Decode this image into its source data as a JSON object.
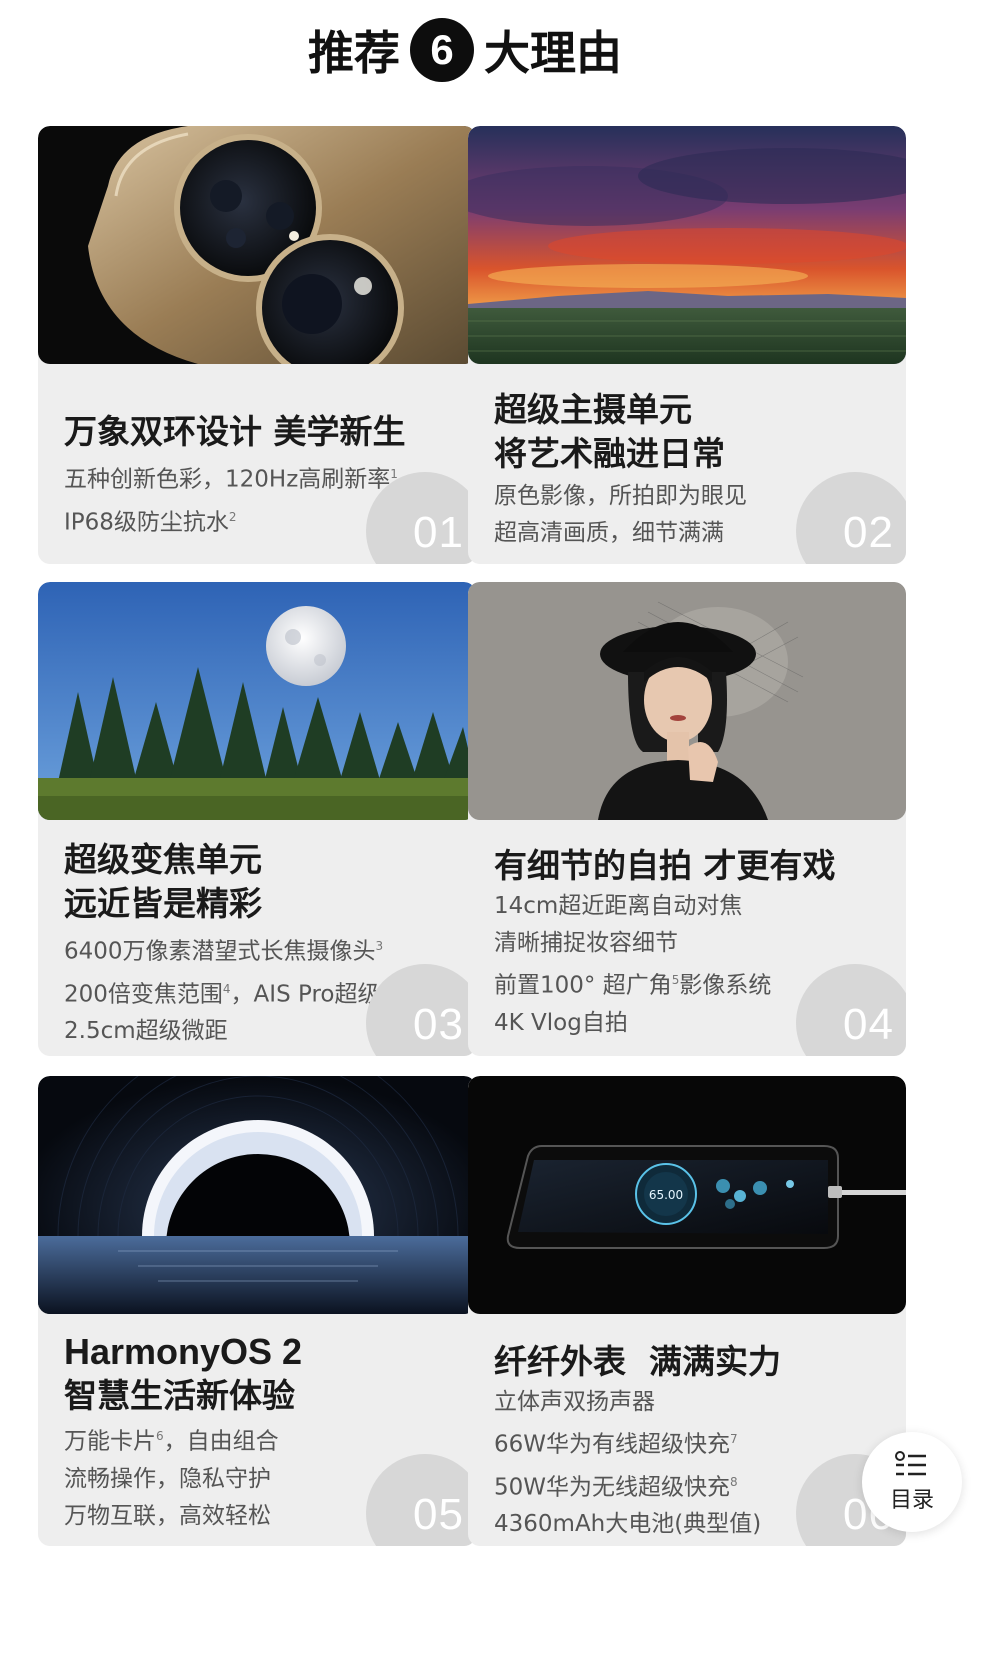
{
  "header": {
    "title_prefix": "推荐",
    "title_number": "6",
    "title_suffix": "大理由"
  },
  "cards": [
    {
      "number": "01",
      "headline": [
        "万象双环设计 美学新生"
      ],
      "lines": [
        {
          "text": "五种创新色彩，120Hz高刷新率",
          "sup": "1"
        },
        {
          "text": "IP68级防尘抗水",
          "sup": "2"
        }
      ]
    },
    {
      "number": "02",
      "headline": [
        "超级主摄单元",
        "将艺术融进日常"
      ],
      "lines": [
        {
          "text": "原色影像，所拍即为眼见",
          "sup": ""
        },
        {
          "text": "超高清画质，细节满满",
          "sup": ""
        }
      ]
    },
    {
      "number": "03",
      "headline": [
        "超级变焦单元",
        "远近皆是精彩"
      ],
      "lines": [
        {
          "text": "6400万像素潜望式长焦摄像头",
          "sup": "3"
        },
        {
          "text_a": "200倍变焦范围",
          "sup": "4",
          "text_b": "，AIS Pro超级防抖"
        },
        {
          "text": "2.5cm超级微距",
          "sup": ""
        }
      ]
    },
    {
      "number": "04",
      "headline": [
        "有细节的自拍 才更有戏"
      ],
      "lines": [
        {
          "text": "14cm超近距离自动对焦",
          "sup": ""
        },
        {
          "text": "清晰捕捉妆容细节",
          "sup": ""
        },
        {
          "text_a": "前置100° 超广角",
          "sup": "5",
          "text_b": "影像系统"
        },
        {
          "text": "4K Vlog自拍",
          "sup": ""
        }
      ]
    },
    {
      "number": "05",
      "headline": [
        "HarmonyOS 2",
        "智慧生活新体验"
      ],
      "lines": [
        {
          "text_a": "万能卡片",
          "sup": "6",
          "text_b": "，自由组合"
        },
        {
          "text": "流畅操作，隐私守护",
          "sup": ""
        },
        {
          "text": "万物互联，高效轻松",
          "sup": ""
        }
      ]
    },
    {
      "number": "06",
      "headline": [
        "纤纤外表  满满实力"
      ],
      "lines": [
        {
          "text": "立体声双扬声器",
          "sup": ""
        },
        {
          "text": "66W华为有线超级快充",
          "sup": "7"
        },
        {
          "text": "50W华为无线超级快充",
          "sup": "8"
        },
        {
          "text": "4360mAh大电池(典型值)",
          "sup": ""
        }
      ]
    }
  ],
  "toc": {
    "label": "目录",
    "icon": "list-menu-icon"
  },
  "phone_screen": {
    "temperature": "65.00"
  },
  "colors": {
    "card_bg": "#eeeeee",
    "badge_bg": "#d7d7d7",
    "title_badge": "#0d0d0d"
  }
}
